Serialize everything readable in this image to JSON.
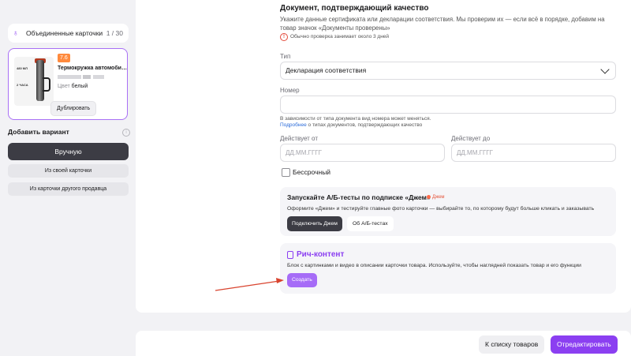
{
  "sidebar": {
    "merged_cards_label": "Объединенные карточки",
    "merged_cards_count": "1 / 30",
    "card": {
      "rating": "7.6",
      "title": "Термокружка автомобильна...",
      "image_text_top": "480 МЛ",
      "image_text_bottom": "2 ЧАСА",
      "color_key": "Цвет",
      "color_value": "белый",
      "duplicate_label": "Дублировать"
    },
    "add_variant_label": "Добавить вариант",
    "manual_label": "Вручную",
    "from_own_label": "Из своей карточки",
    "from_other_label": "Из карточки другого продавца"
  },
  "document": {
    "title": "Документ, подтверждающий качество",
    "description": "Укажите данные сертификата или декларации соответствия. Мы проверим их — если всё в порядке, добавим на товар значок «Документы проверены»",
    "notice": "Обычно проверка занимает около 3 дней",
    "type_label": "Тип",
    "type_value": "Декларация соответствия",
    "number_label": "Номер",
    "number_hint": "В зависимости от типа документа вид номера может меняться.",
    "hint_link": "Подробнее",
    "hint_rest": " о типах документов, подтверждающих качество",
    "valid_from_label": "Действует от",
    "valid_to_label": "Действует до",
    "date_placeholder": "ДД.ММ.ГГГГ",
    "indefinite_label": "Бессрочный"
  },
  "ab_tests": {
    "title": "Запускайте А/Б-тесты по подписке «Джем»",
    "badge": "Джем",
    "description": "Оформите «Джем» и тестируйте главные фото карточки — выбирайте то, по которому будут больше кликать и заказывать",
    "connect_label": "Подключить Джем",
    "about_label": "Об А/Б-тестах"
  },
  "rich_content": {
    "title": "Рич-контент",
    "description": "Блок с картинками и видео в описании карточки товара. Используйте, чтобы наглядней показать товар и его функции",
    "create_label": "Создать"
  },
  "footer": {
    "to_list_label": "К списку товаров",
    "edit_label": "Отредактировать"
  },
  "colors": {
    "accent": "#8b3ff1",
    "dark_button": "#3c3c44",
    "annotation_arrow": "#d9442f",
    "rating_badge": "#ff8a3d"
  }
}
